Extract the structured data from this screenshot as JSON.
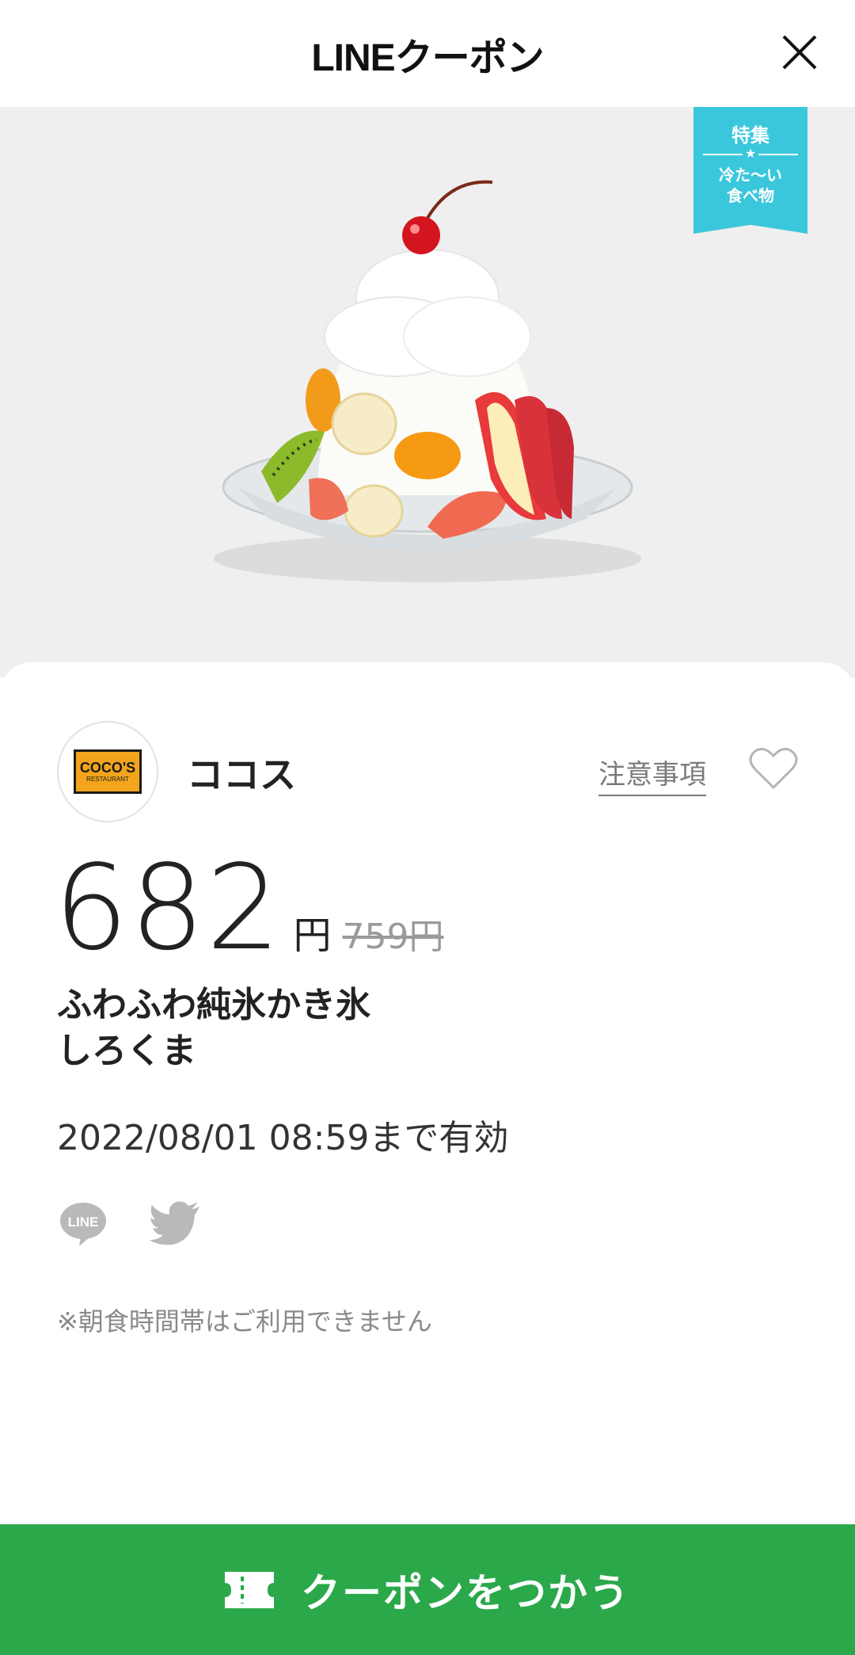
{
  "header": {
    "title": "LINEクーポン",
    "close_icon": "close-icon"
  },
  "badge": {
    "line1": "特集",
    "star": "★",
    "line2": "冷た〜い",
    "line3": "食べ物",
    "color": "#3bc7db"
  },
  "store": {
    "name": "ココス",
    "logo_main": "COCO'S",
    "logo_sub": "RESTAURANT",
    "notes_label": "注意事項",
    "favorite_icon": "heart-outline-icon"
  },
  "price": {
    "value": "682",
    "unit": "円",
    "original": "759円"
  },
  "product": {
    "line1": "ふわふわ純氷かき氷",
    "line2": "しろくま"
  },
  "validity": "2022/08/01 08:59まで有効",
  "share": {
    "line_icon": "line-share-icon",
    "twitter_icon": "twitter-share-icon"
  },
  "notice": "※朝食時間帯はご利用できません",
  "cta": {
    "label": "クーポンをつかう",
    "icon": "ticket-icon",
    "color": "#2ba84a"
  }
}
